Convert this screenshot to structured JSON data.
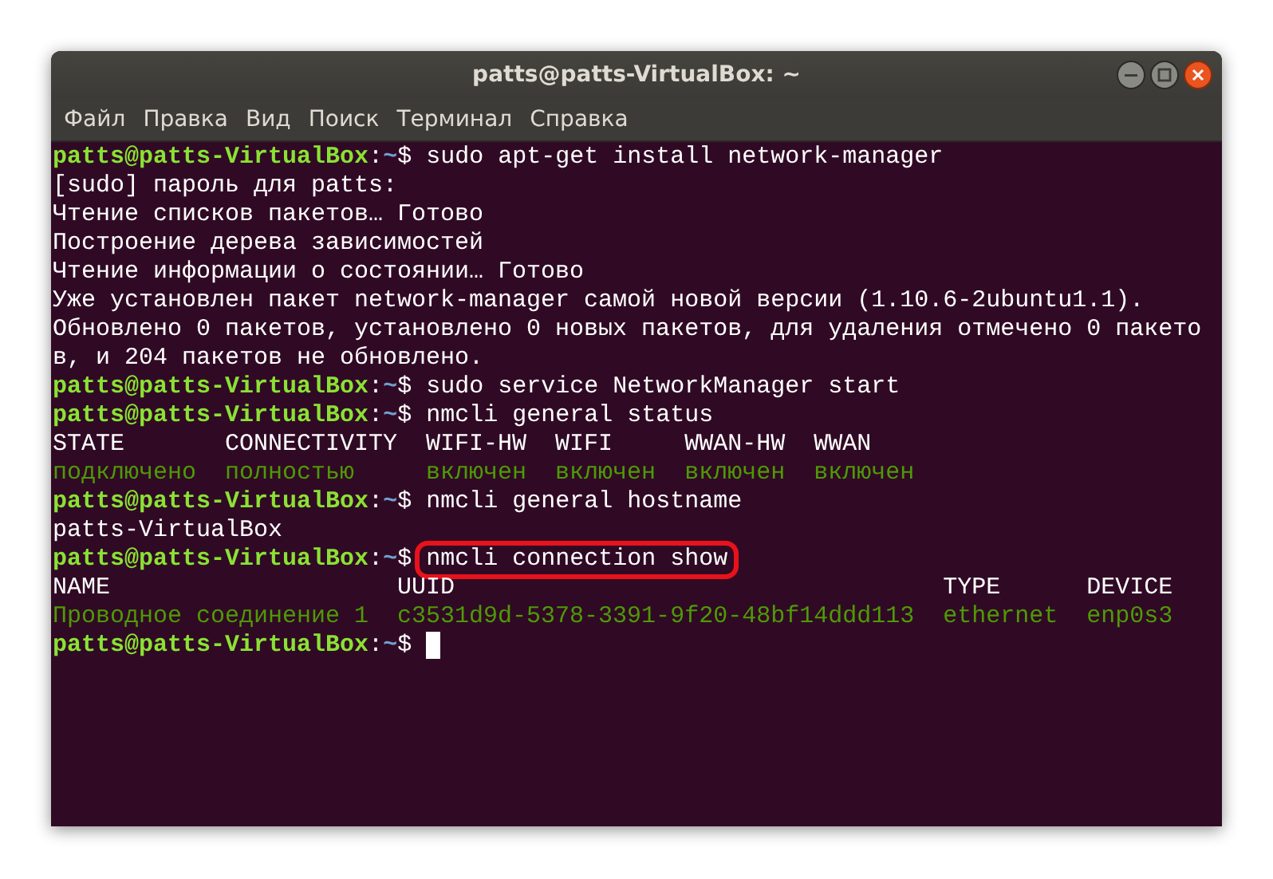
{
  "window": {
    "title": "patts@patts-VirtualBox: ~"
  },
  "menu": [
    "Файл",
    "Правка",
    "Вид",
    "Поиск",
    "Терминал",
    "Справка"
  ],
  "terminal": {
    "lines": [
      {
        "kind": "prompt",
        "user_host": "patts@patts-VirtualBox",
        "separator": ":",
        "path": "~",
        "symbol": "$",
        "command": "sudo apt-get install network-manager"
      },
      {
        "kind": "plain",
        "text": "[sudo] пароль для patts:"
      },
      {
        "kind": "plain",
        "text": "Чтение списков пакетов… Готово"
      },
      {
        "kind": "plain",
        "text": "Построение дерева зависимостей"
      },
      {
        "kind": "plain",
        "text": "Чтение информации о состоянии… Готово"
      },
      {
        "kind": "plain",
        "text": "Уже установлен пакет network-manager самой новой версии (1.10.6-2ubuntu1.1)."
      },
      {
        "kind": "plain",
        "text": "Обновлено 0 пакетов, установлено 0 новых пакетов, для удаления отмечено 0 пакето"
      },
      {
        "kind": "plain",
        "text": "в, и 204 пакетов не обновлено."
      },
      {
        "kind": "prompt",
        "user_host": "patts@patts-VirtualBox",
        "separator": ":",
        "path": "~",
        "symbol": "$",
        "command": "sudo service NetworkManager start"
      },
      {
        "kind": "prompt",
        "user_host": "patts@patts-VirtualBox",
        "separator": ":",
        "path": "~",
        "symbol": "$",
        "command": "nmcli general status"
      },
      {
        "kind": "plain",
        "text": "STATE       CONNECTIVITY  WIFI-HW  WIFI     WWAN-HW  WWAN"
      },
      {
        "kind": "data",
        "text": "подключено  полностью     включен  включен  включен  включен"
      },
      {
        "kind": "prompt",
        "user_host": "patts@patts-VirtualBox",
        "separator": ":",
        "path": "~",
        "symbol": "$",
        "command": "nmcli general hostname"
      },
      {
        "kind": "plain",
        "text": "patts-VirtualBox"
      },
      {
        "kind": "prompt",
        "user_host": "patts@patts-VirtualBox",
        "separator": ":",
        "path": "~",
        "symbol": "$",
        "command": "nmcli connection show",
        "highlighted": true
      },
      {
        "kind": "plain",
        "text": "NAME                    UUID                                  TYPE      DEVICE"
      },
      {
        "kind": "data",
        "text": "Проводное соединение 1  c3531d9d-5378-3391-9f20-48bf14ddd113  ethernet  enp0s3"
      },
      {
        "kind": "prompt",
        "user_host": "patts@patts-VirtualBox",
        "separator": ":",
        "path": "~",
        "symbol": "$",
        "cursor": true
      }
    ]
  }
}
